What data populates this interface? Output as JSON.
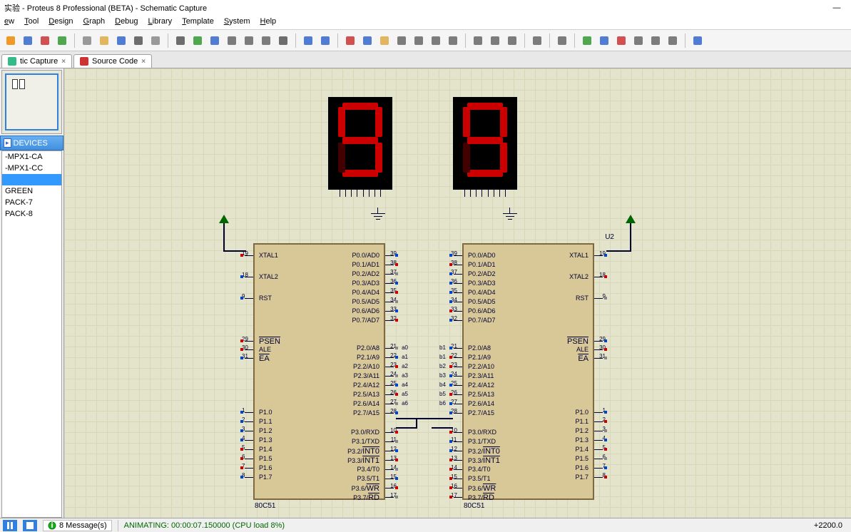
{
  "title": "实验 - Proteus 8 Professional (BETA) - Schematic Capture",
  "menu": [
    "ew",
    "Tool",
    "Design",
    "Graph",
    "Debug",
    "Library",
    "Template",
    "System",
    "Help"
  ],
  "tabs": [
    {
      "label": "tic Capture",
      "icon": "#3b8"
    },
    {
      "label": "Source Code",
      "icon": "#c33"
    }
  ],
  "devices_header": "DEVICES",
  "devices": [
    {
      "label": "-MPX1-CA",
      "sel": false
    },
    {
      "label": "-MPX1-CC",
      "sel": false
    },
    {
      "label": "",
      "sel": true
    },
    {
      "label": "GREEN",
      "sel": false
    },
    {
      "label": "PACK-7",
      "sel": false
    },
    {
      "label": "PACK-8",
      "sel": false
    }
  ],
  "chip_u1": {
    "ref": "",
    "name": "80C51",
    "left_pins": [
      {
        "n": "19",
        "lbl": "XTAL1"
      },
      {
        "n": "18",
        "lbl": "XTAL2"
      },
      {
        "n": "9",
        "lbl": "RST"
      },
      {
        "n": "29",
        "lbl": "PSEN",
        "ov": true
      },
      {
        "n": "30",
        "lbl": "ALE"
      },
      {
        "n": "31",
        "lbl": "EA",
        "ov": true
      },
      {
        "n": "1",
        "lbl": "P1.0"
      },
      {
        "n": "2",
        "lbl": "P1.1"
      },
      {
        "n": "3",
        "lbl": "P1.2"
      },
      {
        "n": "4",
        "lbl": "P1.3"
      },
      {
        "n": "5",
        "lbl": "P1.4"
      },
      {
        "n": "6",
        "lbl": "P1.5"
      },
      {
        "n": "7",
        "lbl": "P1.6"
      },
      {
        "n": "8",
        "lbl": "P1.7"
      }
    ],
    "right_pins": [
      {
        "n": "39",
        "lbl": "P0.0/AD0"
      },
      {
        "n": "38",
        "lbl": "P0.1/AD1"
      },
      {
        "n": "37",
        "lbl": "P0.2/AD2"
      },
      {
        "n": "36",
        "lbl": "P0.3/AD3"
      },
      {
        "n": "35",
        "lbl": "P0.4/AD4"
      },
      {
        "n": "34",
        "lbl": "P0.5/AD5"
      },
      {
        "n": "33",
        "lbl": "P0.6/AD6"
      },
      {
        "n": "32",
        "lbl": "P0.7/AD7"
      },
      {
        "n": "21",
        "lbl": "P2.0/A8",
        "net": "a0"
      },
      {
        "n": "22",
        "lbl": "P2.1/A9",
        "net": "a1"
      },
      {
        "n": "23",
        "lbl": "P2.2/A10",
        "net": "a2"
      },
      {
        "n": "24",
        "lbl": "P2.3/A11",
        "net": "a3"
      },
      {
        "n": "25",
        "lbl": "P2.4/A12",
        "net": "a4"
      },
      {
        "n": "26",
        "lbl": "P2.5/A13",
        "net": "a5"
      },
      {
        "n": "27",
        "lbl": "P2.6/A14",
        "net": "a6"
      },
      {
        "n": "28",
        "lbl": "P2.7/A15"
      },
      {
        "n": "10",
        "lbl": "P3.0/RXD"
      },
      {
        "n": "11",
        "lbl": "P3.1/TXD"
      },
      {
        "n": "12",
        "lbl": "P3.2/INT0",
        "ov": "INT0"
      },
      {
        "n": "13",
        "lbl": "P3.3/INT1",
        "ov": "INT1"
      },
      {
        "n": "14",
        "lbl": "P3.4/T0"
      },
      {
        "n": "15",
        "lbl": "P3.5/T1"
      },
      {
        "n": "16",
        "lbl": "P3.6/WR",
        "ov": "WR"
      },
      {
        "n": "17",
        "lbl": "P3.7/RD",
        "ov": "RD"
      }
    ]
  },
  "chip_u2": {
    "ref": "U2",
    "name": "80C51",
    "left_pins": [
      {
        "n": "39",
        "lbl": "P0.0/AD0"
      },
      {
        "n": "38",
        "lbl": "P0.1/AD1"
      },
      {
        "n": "37",
        "lbl": "P0.2/AD2"
      },
      {
        "n": "36",
        "lbl": "P0.3/AD3"
      },
      {
        "n": "35",
        "lbl": "P0.4/AD4"
      },
      {
        "n": "34",
        "lbl": "P0.5/AD5"
      },
      {
        "n": "33",
        "lbl": "P0.6/AD6"
      },
      {
        "n": "32",
        "lbl": "P0.7/AD7"
      },
      {
        "n": "21",
        "lbl": "P2.0/A8",
        "net": "b1"
      },
      {
        "n": "22",
        "lbl": "P2.1/A9",
        "net": "b1"
      },
      {
        "n": "23",
        "lbl": "P2.2/A10",
        "net": "b2"
      },
      {
        "n": "24",
        "lbl": "P2.3/A11",
        "net": "b3"
      },
      {
        "n": "25",
        "lbl": "P2.4/A12",
        "net": "b4"
      },
      {
        "n": "26",
        "lbl": "P2.5/A13",
        "net": "b5"
      },
      {
        "n": "27",
        "lbl": "P2.6/A14",
        "net": "b6"
      },
      {
        "n": "28",
        "lbl": "P2.7/A15"
      },
      {
        "n": "10",
        "lbl": "P3.0/RXD"
      },
      {
        "n": "11",
        "lbl": "P3.1/TXD"
      },
      {
        "n": "12",
        "lbl": "P3.2/INT0",
        "ov": "INT0"
      },
      {
        "n": "13",
        "lbl": "P3.3/INT1",
        "ov": "INT1"
      },
      {
        "n": "14",
        "lbl": "P3.4/T0"
      },
      {
        "n": "15",
        "lbl": "P3.5/T1"
      },
      {
        "n": "16",
        "lbl": "P3.6/WR",
        "ov": "WR"
      },
      {
        "n": "17",
        "lbl": "P3.7/RD",
        "ov": "RD"
      }
    ],
    "right_pins": [
      {
        "n": "19",
        "lbl": "XTAL1"
      },
      {
        "n": "18",
        "lbl": "XTAL2"
      },
      {
        "n": "9",
        "lbl": "RST"
      },
      {
        "n": "29",
        "lbl": "PSEN",
        "ov": true
      },
      {
        "n": "30",
        "lbl": "ALE"
      },
      {
        "n": "31",
        "lbl": "EA",
        "ov": true
      },
      {
        "n": "1",
        "lbl": "P1.0"
      },
      {
        "n": "2",
        "lbl": "P1.1"
      },
      {
        "n": "3",
        "lbl": "P1.2"
      },
      {
        "n": "4",
        "lbl": "P1.3"
      },
      {
        "n": "5",
        "lbl": "P1.4"
      },
      {
        "n": "6",
        "lbl": "P1.5"
      },
      {
        "n": "7",
        "lbl": "P1.6"
      },
      {
        "n": "8",
        "lbl": "P1.7"
      }
    ]
  },
  "seven_seg": {
    "digit": "9"
  },
  "status": {
    "messages": "8 Message(s)",
    "anim": "ANIMATING: 00:00:07.150000 (CPU load 8%)",
    "coord": "+2200.0"
  },
  "toolbar_icons": [
    "home",
    "isis",
    "ares",
    "vsmlib",
    "sep",
    "new",
    "open",
    "save",
    "print",
    "area",
    "sep",
    "grid",
    "origin",
    "pan",
    "zoom-in",
    "zoom-out",
    "zoom-area",
    "zoom-all",
    "sep",
    "undo",
    "redo",
    "sep",
    "cut",
    "copy",
    "paste",
    "block-copy",
    "block-move",
    "block-rotate",
    "block-delete",
    "sep",
    "pick",
    "wire-label",
    "script",
    "sep",
    "terminals",
    "sep",
    "play-group",
    "sep",
    "erc",
    "netlist",
    "bom",
    "new-sheet",
    "del-sheet",
    "find",
    "sep",
    "help"
  ]
}
